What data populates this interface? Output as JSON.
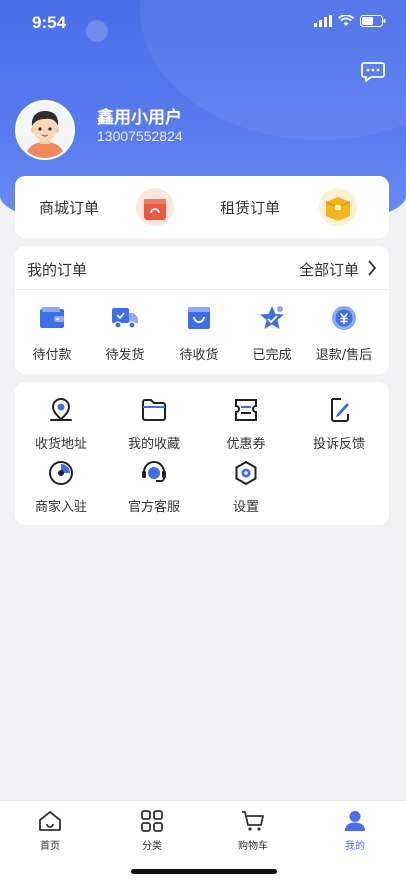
{
  "status_bar": {
    "time": "9:54"
  },
  "profile": {
    "username": "鑫用小用户",
    "phone": "13007552824"
  },
  "order_types": [
    {
      "label": "商城订单",
      "icon": "mall-order-icon"
    },
    {
      "label": "租赁订单",
      "icon": "lease-order-icon"
    }
  ],
  "my_orders": {
    "title": "我的订单",
    "all_label": "全部订单",
    "statuses": [
      {
        "label": "待付款",
        "icon": "wallet-icon"
      },
      {
        "label": "待发货",
        "icon": "truck-icon"
      },
      {
        "label": "待收货",
        "icon": "shopping-bag-icon"
      },
      {
        "label": "已完成",
        "icon": "star-check-icon"
      },
      {
        "label": "退款/售后",
        "icon": "refund-icon"
      }
    ]
  },
  "services": [
    {
      "label": "收货地址",
      "icon": "location-icon"
    },
    {
      "label": "我的收藏",
      "icon": "folder-icon"
    },
    {
      "label": "优惠券",
      "icon": "coupon-icon"
    },
    {
      "label": "投诉反馈",
      "icon": "feedback-icon"
    },
    {
      "label": "商家入驻",
      "icon": "merchant-icon"
    },
    {
      "label": "官方客服",
      "icon": "customer-service-icon"
    },
    {
      "label": "设置",
      "icon": "settings-icon"
    }
  ],
  "tabbar": [
    {
      "label": "首页",
      "icon": "home-icon"
    },
    {
      "label": "分类",
      "icon": "category-icon"
    },
    {
      "label": "购物车",
      "icon": "cart-icon"
    },
    {
      "label": "我的",
      "icon": "profile-icon"
    }
  ],
  "colors": {
    "accent": "#4a6ee8",
    "header_gradient_top": "#4a6ee8",
    "header_gradient_bottom": "#6d8ef5"
  }
}
